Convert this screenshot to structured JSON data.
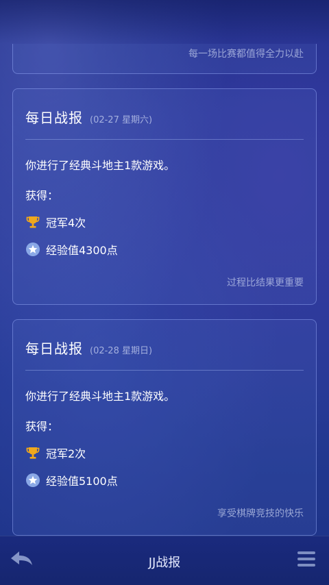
{
  "partial_card": {
    "footer": "每一场比赛都值得全力以赴"
  },
  "cards": [
    {
      "title": "每日战报",
      "date": "(02-27 星期六)",
      "description": "你进行了经典斗地主1款游戏。",
      "gain_label": "获得：",
      "rewards": [
        {
          "icon": "trophy-icon",
          "text": "冠军4次"
        },
        {
          "icon": "star-icon",
          "text": "经验值4300点"
        }
      ],
      "footer": "过程比结果更重要"
    },
    {
      "title": "每日战报",
      "date": "(02-28 星期日)",
      "description": "你进行了经典斗地主1款游戏。",
      "gain_label": "获得：",
      "rewards": [
        {
          "icon": "trophy-icon",
          "text": "冠军2次"
        },
        {
          "icon": "star-icon",
          "text": "经验值5100点"
        }
      ],
      "footer": "享受棋牌竞技的快乐"
    }
  ],
  "bottom_bar": {
    "title": "JJ战报",
    "back_icon": "back-arrow-icon",
    "menu_icon": "menu-icon"
  },
  "colors": {
    "trophy": "#f0a81c",
    "star_badge": "#8aa8e6",
    "card_border": "#a0b4ff"
  }
}
